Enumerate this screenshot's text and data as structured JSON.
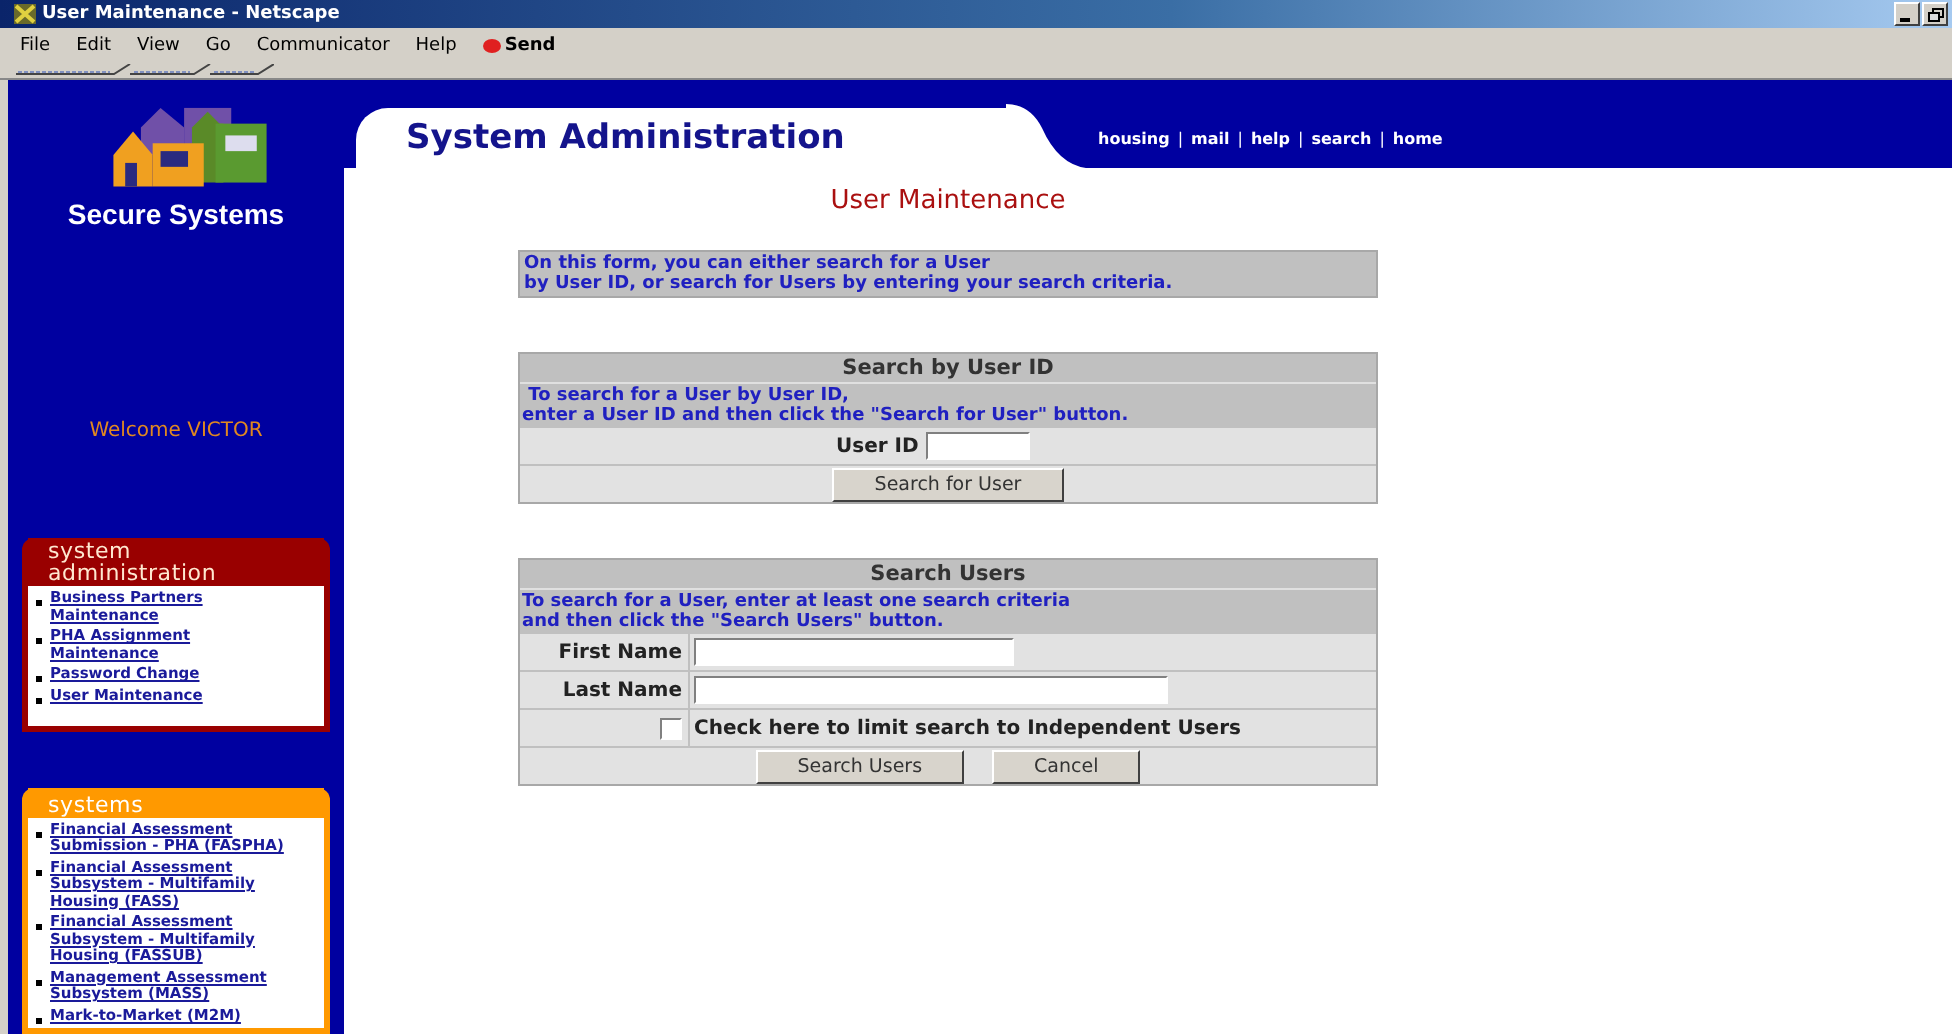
{
  "window": {
    "title": "User Maintenance - Netscape"
  },
  "menu": [
    "File",
    "Edit",
    "View",
    "Go",
    "Communicator",
    "Help"
  ],
  "send_button": "Send",
  "sidebar": {
    "brand": "Secure Systems",
    "welcome": "Welcome VICTOR",
    "panels": [
      {
        "kind": "admin",
        "title": "system administration",
        "links": [
          "Business Partners Maintenance",
          "PHA Assignment Maintenance",
          "Password Change",
          "User Maintenance"
        ]
      },
      {
        "kind": "systems",
        "title": "systems",
        "links": [
          "Financial Assessment Submission - PHA (FASPHA)",
          "Financial Assessment Subsystem - Multifamily Housing (FASS)",
          "Financial Assessment Subsystem - Multifamily Housing (FASSUB)",
          "Management Assessment Subsystem (MASS)",
          "Mark-to-Market (M2M)"
        ]
      }
    ]
  },
  "header": {
    "title": "System Administration",
    "separator": "|",
    "links": [
      "housing",
      "mail",
      "help",
      "search",
      "home"
    ]
  },
  "page_title": "User Maintenance",
  "intro": [
    "On this form, you can either search for a User",
    "by User ID, or search for Users by entering your search criteria."
  ],
  "search_by_id": {
    "title": "Search by User ID",
    "instructions": [
      " To search for a User by User ID,",
      "enter a User ID and then click the \"Search for User\" button."
    ],
    "field_label": "User ID",
    "button": "Search for User"
  },
  "search_users": {
    "title": "Search Users",
    "instructions": [
      "To search for a User, enter at least one search criteria",
      "and then click the \"Search Users\" button."
    ],
    "fields": [
      {
        "label": "First Name",
        "kind": "short"
      },
      {
        "label": "Last Name",
        "kind": "long"
      }
    ],
    "checkbox": {
      "label": "Check here to limit search to Independent Users",
      "checked": false
    },
    "buttons": [
      "Search Users",
      "Cancel"
    ]
  }
}
